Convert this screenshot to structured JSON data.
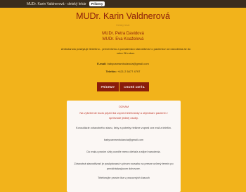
{
  "topbar": {
    "breadcrumb": "MUDr. Karin Valdnerová - detský lekár",
    "button_label": "Prikrmy"
  },
  "header": {
    "title": "MUDr. Karin Valdnerová",
    "subtitle": "Detský lekár"
  },
  "doctors": [
    "MUDr. Petra Davidová",
    "MUDr. Eva Koaželová"
  ],
  "intro": "Ambulancia poskytuje liečebno - preventívnu a poradenskú starostlivosť o pacientov od narodenia až do veku 26 rokov.",
  "contact": {
    "email_label": "E-mail:",
    "email_value": "babycareambulancia@gmail.com",
    "phone_label": "Telefón:",
    "phone_value": "+421 2 5477 4797"
  },
  "buttons": {
    "prikrmy": "PRÍKRMY",
    "chore_dieta": "CHORÉ DIEŤA"
  },
  "notice": {
    "heading": "OZNAM",
    "lines_red": [
      "Na vyšetrenie budú prijatí iba vopred telefonicky a objednaní pacienti v",
      "sprievode jednej osoby."
    ],
    "lines": [
      "Konzultácie zdravotného stavu, lieky a potreby riešime vopred cez mail a telefón.",
      "babycareambulancia@gmail.com",
      "Do maku prosím vždy uveďte meno dieťaťa a stĺpel narodenia.",
      "Zdravotná starostlivosť je poskytovaná v plnom rozsahu na presne určený termín po",
      "predchádzajúcom dohovore.",
      "Telefonujte prosím iba v pracovných časoch"
    ]
  },
  "colors": {
    "background": "#f2b31b",
    "accent": "#8a1c0b",
    "topbar": "#3a2d1d",
    "card": "#fbf7f4",
    "notice_red": "#c0392b"
  }
}
